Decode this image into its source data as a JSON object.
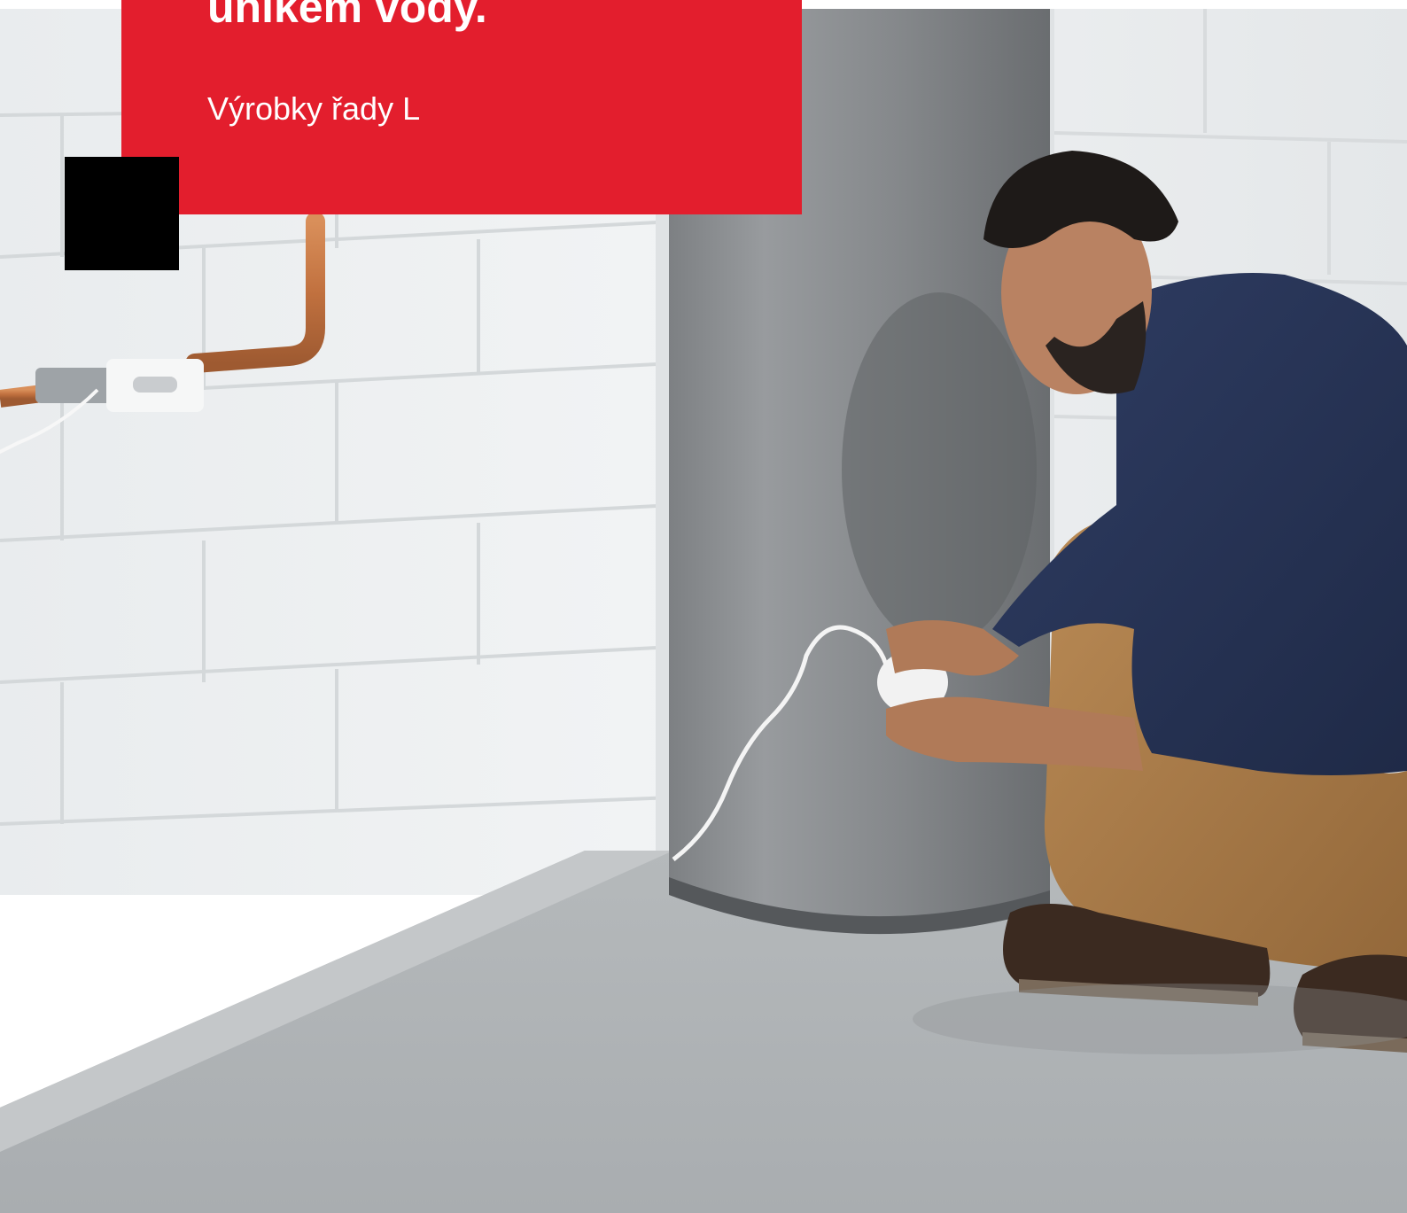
{
  "header": {
    "headline": "únikem vody.",
    "subtitle": "Výrobky řady L"
  },
  "colors": {
    "accent_red": "#e31e2d",
    "square_black": "#000000",
    "text_white": "#ffffff"
  }
}
